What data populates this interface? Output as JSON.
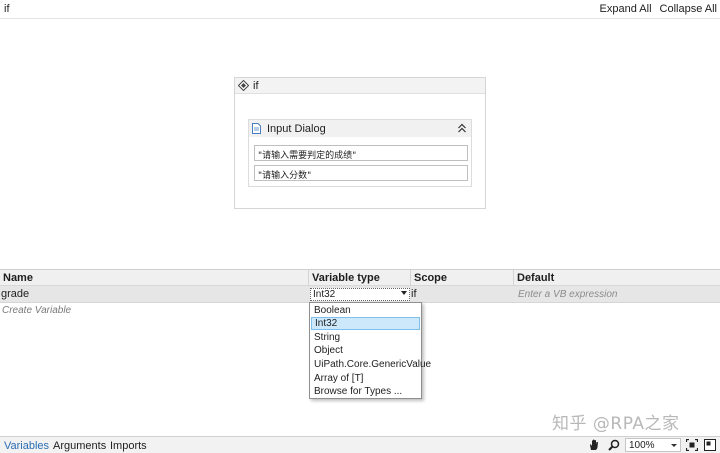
{
  "breadcrumb": "if",
  "toolbar": {
    "expand_all": "Expand All",
    "collapse_all": "Collapse All"
  },
  "if_activity": {
    "title": "if"
  },
  "input_dialog": {
    "title": "Input Dialog",
    "title_field": "\"请输入需要判定的成绩\"",
    "label_field": "\"请输入分数\""
  },
  "variables": {
    "headers": {
      "name": "Name",
      "type": "Variable type",
      "scope": "Scope",
      "default": "Default"
    },
    "rows": [
      {
        "name": "grade",
        "type": "Int32",
        "scope": "if",
        "default_placeholder": "Enter a VB expression"
      }
    ],
    "create_placeholder": "Create Variable"
  },
  "type_dropdown": {
    "options": [
      "Boolean",
      "Int32",
      "String",
      "Object",
      "UiPath.Core.GenericValue",
      "Array of [T]",
      "Browse for Types ..."
    ],
    "selected": "Int32"
  },
  "bottom_tabs": [
    "Variables",
    "Arguments",
    "Imports"
  ],
  "active_tab": "Variables",
  "zoom": "100%",
  "watermark": "知乎 @RPA之家",
  "colors": {
    "accent": "#2a6eb3",
    "selected_bg": "#cde8fb",
    "row_bg": "#e6e6e6"
  }
}
